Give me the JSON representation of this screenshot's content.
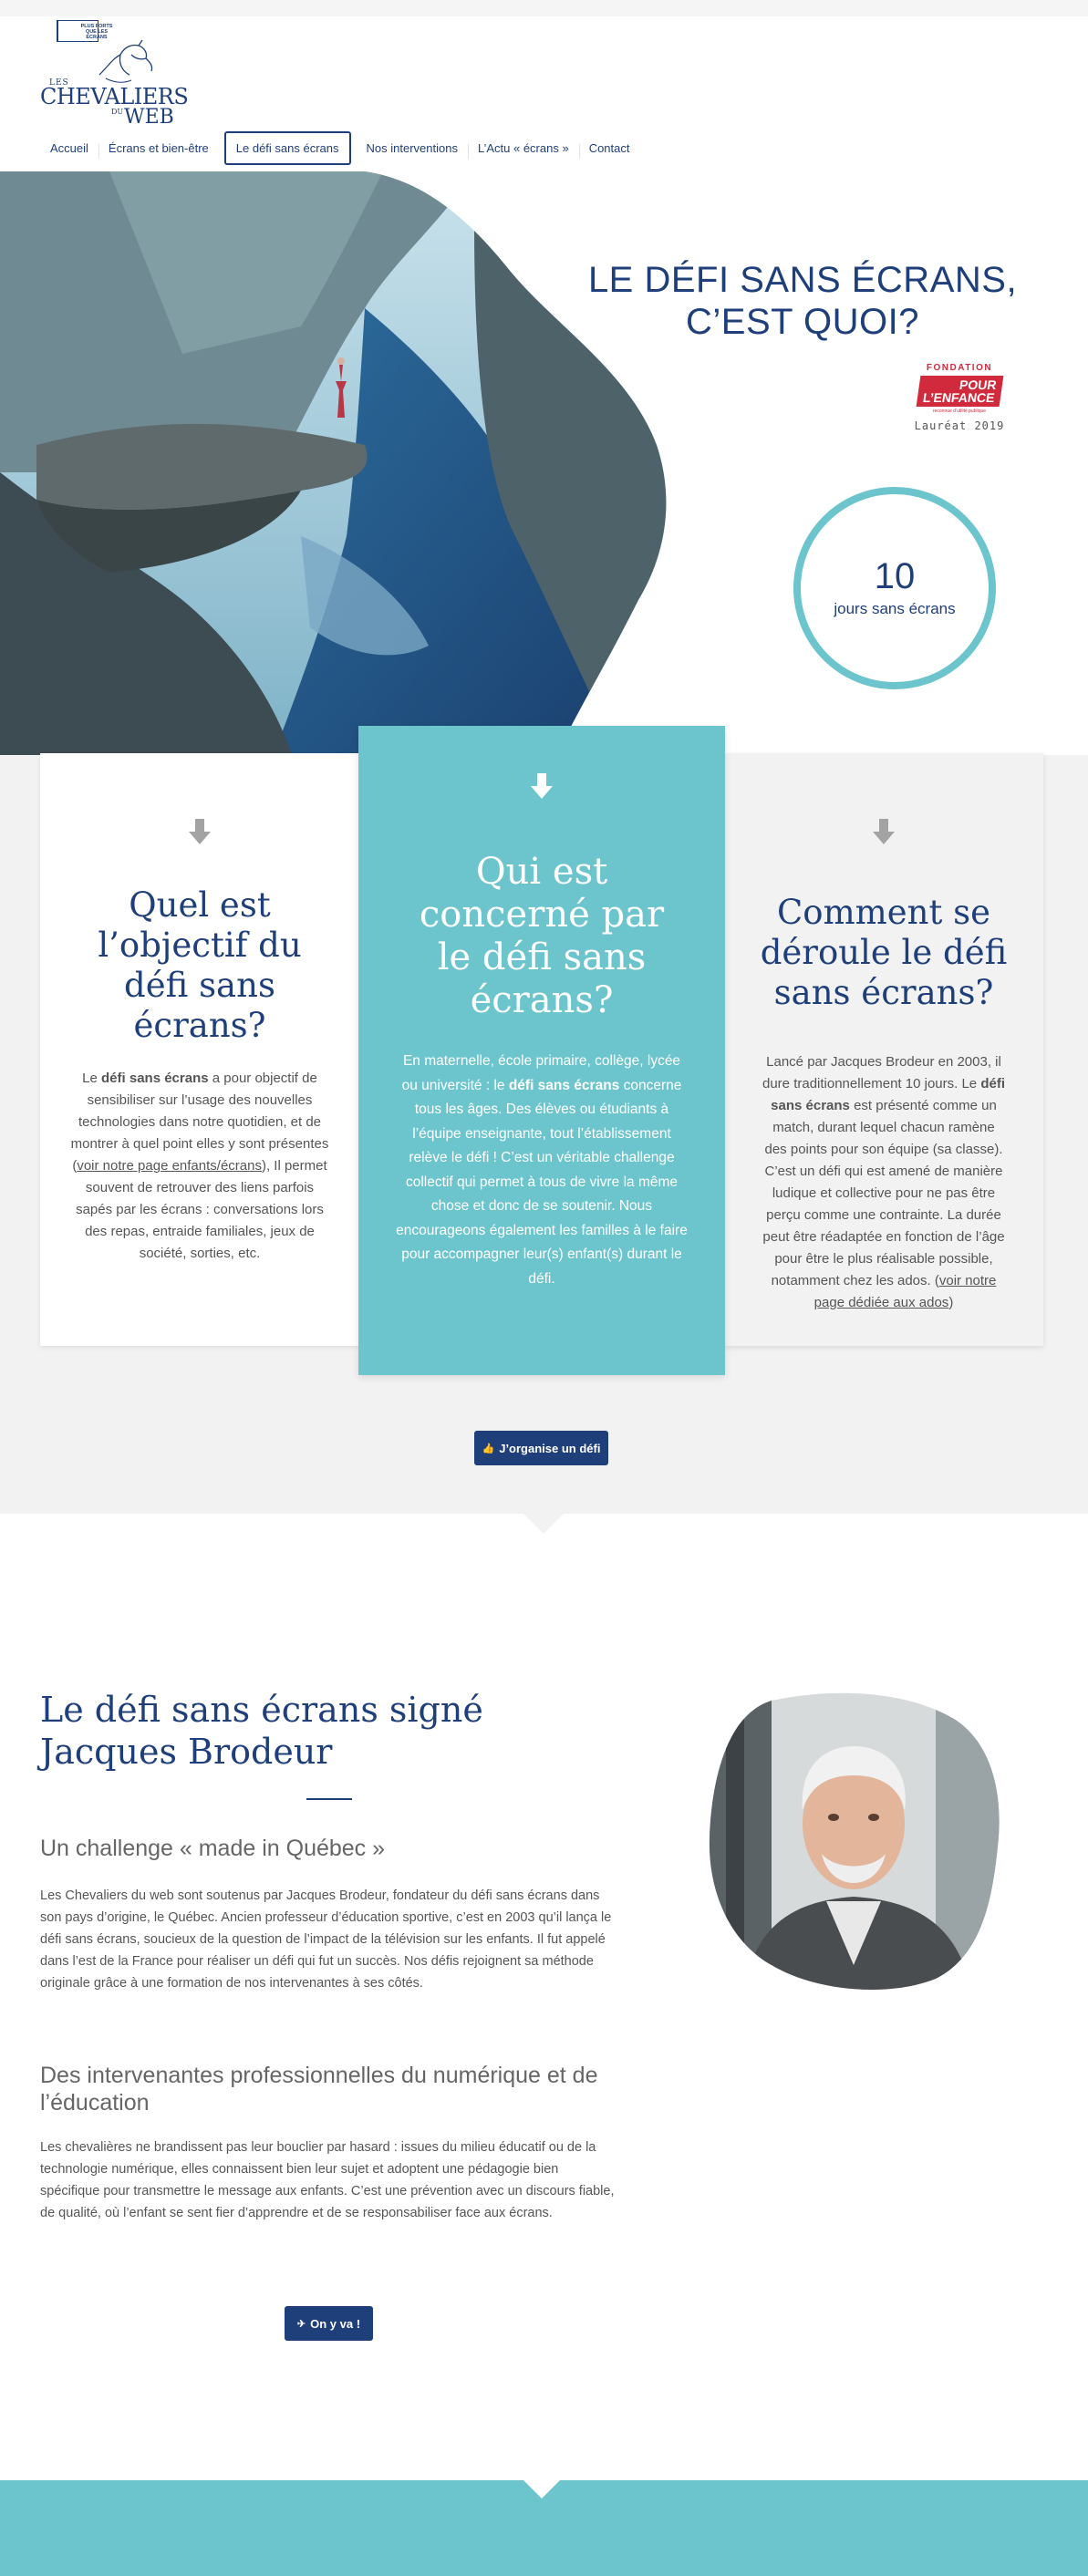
{
  "header": {
    "logo": {
      "tag": "PLUS FORTS QUE LES ÉCRANS",
      "les": "LES",
      "chevaliers": "CHEVALIERS",
      "du": "DU",
      "web": "WEB"
    },
    "nav": [
      {
        "label": "Accueil"
      },
      {
        "label": "Écrans et bien-être"
      },
      {
        "label": "Le défi sans écrans"
      },
      {
        "label": "Nos interventions"
      },
      {
        "label": "L’Actu « écrans »"
      },
      {
        "label": "Contact"
      }
    ],
    "active_nav": "Le défi sans écrans"
  },
  "hero": {
    "title_line1": "LE DÉFI SANS ÉCRANS,",
    "title_line2": "C’EST QUOI?",
    "badge": {
      "top": "FONDATION",
      "line1": "POUR",
      "line2": "L’ENFANCE",
      "sub": "reconnue d’utilité publique",
      "year": "Lauréat 2019"
    },
    "counter": {
      "number": "10",
      "label": "jours sans écrans"
    }
  },
  "cards": {
    "left": {
      "title": "Quel est l’objectif du défi sans écrans?",
      "t1": "Le ",
      "b1": "défi sans écrans",
      "t2": " a pour objectif de sensibiliser sur l’usage des nouvelles technologies dans notre quotidien, et de montrer à quel point elles y sont présentes (",
      "link": "voir notre page enfants/écrans",
      "t3": "), Il permet souvent de retrouver des liens parfois sapés par les écrans : conversations lors des repas, entraide familiales, jeux de société, sorties, etc."
    },
    "middle": {
      "title": "Qui est concerné par le défi sans écrans?",
      "t1": "En maternelle, école primaire, collège, lycée ou université : le ",
      "b1": "défi sans écrans",
      "t2": " concerne tous les âges.  Des élèves ou étudiants à l’équipe enseignante, tout l’établissement relève le défi ! C’est un véritable challenge collectif qui permet à tous de vivre la même chose et donc de se soutenir. Nous encourageons également les familles à le faire pour accompagner leur(s) enfant(s) durant le défi."
    },
    "right": {
      "title": "Comment se déroule le défi sans écrans?",
      "t1": "Lancé par Jacques Brodeur en 2003, il dure traditionnellement 10 jours. Le ",
      "b1": "défi sans écrans",
      "t2": " est présenté comme un match, durant lequel chacun ramène des points pour son équipe (sa classe). C’est un défi qui est amené de manière ludique et collective pour ne pas être perçu comme une contrainte. La durée peut être réadaptée en fonction de l’âge pour être le plus réalisable possible, notamment chez les ados. (",
      "link": "voir notre page dédiée aux ados",
      "t3": ")"
    },
    "cta": {
      "icon": "👍",
      "label": "J’organise un défi"
    }
  },
  "signed": {
    "title": "Le défi sans écrans signé Jacques Brodeur",
    "subtitle1": "Un challenge « made in Québec »",
    "text1": "Les Chevaliers du web sont soutenus par Jacques Brodeur,  fondateur du défi sans écrans dans son pays d’origine, le Québec. Ancien professeur d’éducation sportive, c’est en 2003 qu’il lança le défi sans écrans, soucieux de la question de l’impact de la télévision sur les enfants. Il fut appelé dans l’est de la France pour réaliser un défi qui fut un succès. Nos défis rejoignent sa méthode originale grâce à une formation de nos intervenantes à ses côtés.",
    "subtitle2": "Des intervenantes professionnelles du numérique et de l’éducation",
    "text2": "Les chevalières ne brandissent pas leur bouclier par hasard  : issues du milieu éducatif ou de la technologie numérique, elles connaissent bien leur sujet et adoptent une pédagogie bien spécifique pour transmettre le message aux enfants. C’est une prévention avec un discours fiable, de qualité, où l’enfant se sent fier d’apprendre et de se responsabiliser face aux écrans.",
    "cta": {
      "icon": "✈",
      "label": "On y va !"
    }
  },
  "colors": {
    "navy": "#1f3f7a",
    "teal": "#6cc4cd",
    "red": "#d12a3c",
    "grey_bg": "#f2f2f2"
  }
}
